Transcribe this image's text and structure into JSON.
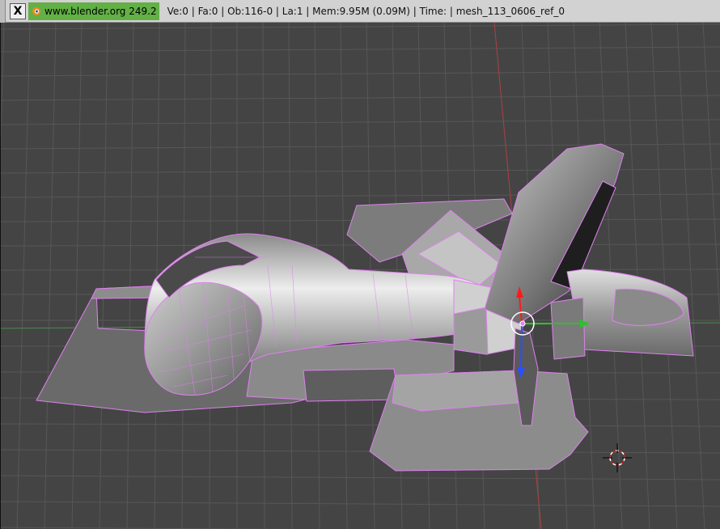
{
  "infobar": {
    "close_label": "X",
    "version_label": "www.blender.org 249.2",
    "stats_text": "Ve:0 | Fa:0 | Ob:116-0 | La:1  | Mem:9.95M (0.09M)  | Time: | mesh_113_0606_ref_0"
  },
  "viewport": {
    "grid_color": "#555555",
    "x_axis_color": "#4d8a4d",
    "y_axis_color": "#b04040",
    "selection_outline_color": "#e080f0",
    "manipulator": {
      "x_color": "#2ec02e",
      "y_color": "#ff1a1a",
      "z_color": "#2a4fff"
    }
  }
}
